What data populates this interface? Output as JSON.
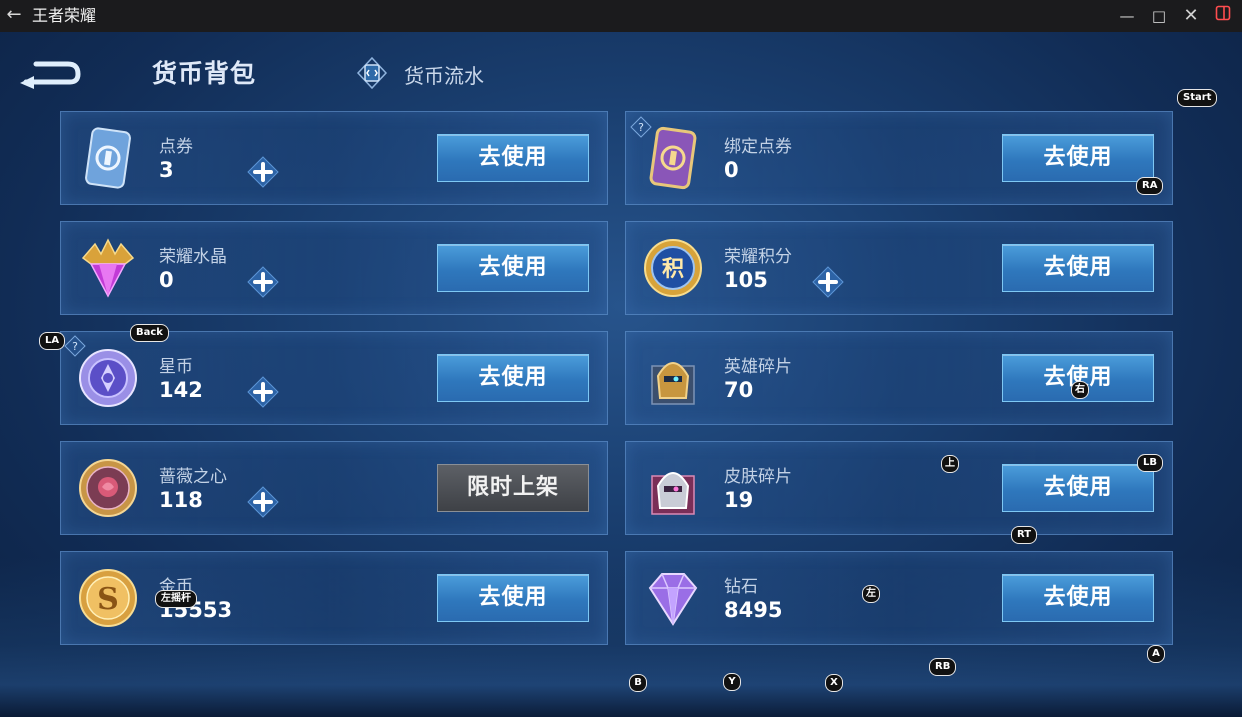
{
  "window": {
    "title": "王者荣耀",
    "back_glyph": "←",
    "minimize_glyph": "—",
    "maximize_glyph": "□",
    "close_glyph": "✕"
  },
  "header": {
    "active_tab": "货币背包",
    "flow_tab": "货币流水"
  },
  "colors": {
    "button_blue": "#3a86c8",
    "button_gray": "#4a4d52",
    "card_border": "#6ea0dc",
    "text_value": "#ffffff"
  },
  "currencies": [
    {
      "name": "点券",
      "value": "3",
      "icon": "voucher-card-icon",
      "has_plus": true,
      "action": "去使用"
    },
    {
      "name": "绑定点券",
      "value": "0",
      "icon": "bound-voucher-card-icon",
      "has_plus": false,
      "action": "去使用"
    },
    {
      "name": "荣耀水晶",
      "value": "0",
      "icon": "glory-crystal-icon",
      "has_plus": true,
      "action": "去使用"
    },
    {
      "name": "荣耀积分",
      "value": "105",
      "icon": "glory-points-icon",
      "has_plus": true,
      "action": "去使用"
    },
    {
      "name": "星币",
      "value": "142",
      "icon": "star-coin-icon",
      "has_plus": true,
      "action": "去使用"
    },
    {
      "name": "英雄碎片",
      "value": "70",
      "icon": "hero-fragment-icon",
      "has_plus": false,
      "action": "去使用"
    },
    {
      "name": "蔷薇之心",
      "value": "118",
      "icon": "rose-heart-icon",
      "has_plus": true,
      "action": "限时上架"
    },
    {
      "name": "皮肤碎片",
      "value": "19",
      "icon": "skin-fragment-icon",
      "has_plus": false,
      "action": "去使用"
    },
    {
      "name": "金币",
      "value": "15553",
      "icon": "gold-coin-icon",
      "has_plus": false,
      "action": "去使用"
    },
    {
      "name": "钻石",
      "value": "8495",
      "icon": "diamond-icon",
      "has_plus": false,
      "action": "去使用"
    }
  ],
  "overlay_labels": {
    "start": "Start",
    "ra": "RA",
    "la": "LA",
    "back": "Back",
    "right": "右",
    "up": "上",
    "lb": "LB",
    "rt": "RT",
    "left_stick": "左摇杆",
    "left": "左",
    "a": "A",
    "rb": "RB",
    "b": "B",
    "y": "Y",
    "x": "X"
  }
}
